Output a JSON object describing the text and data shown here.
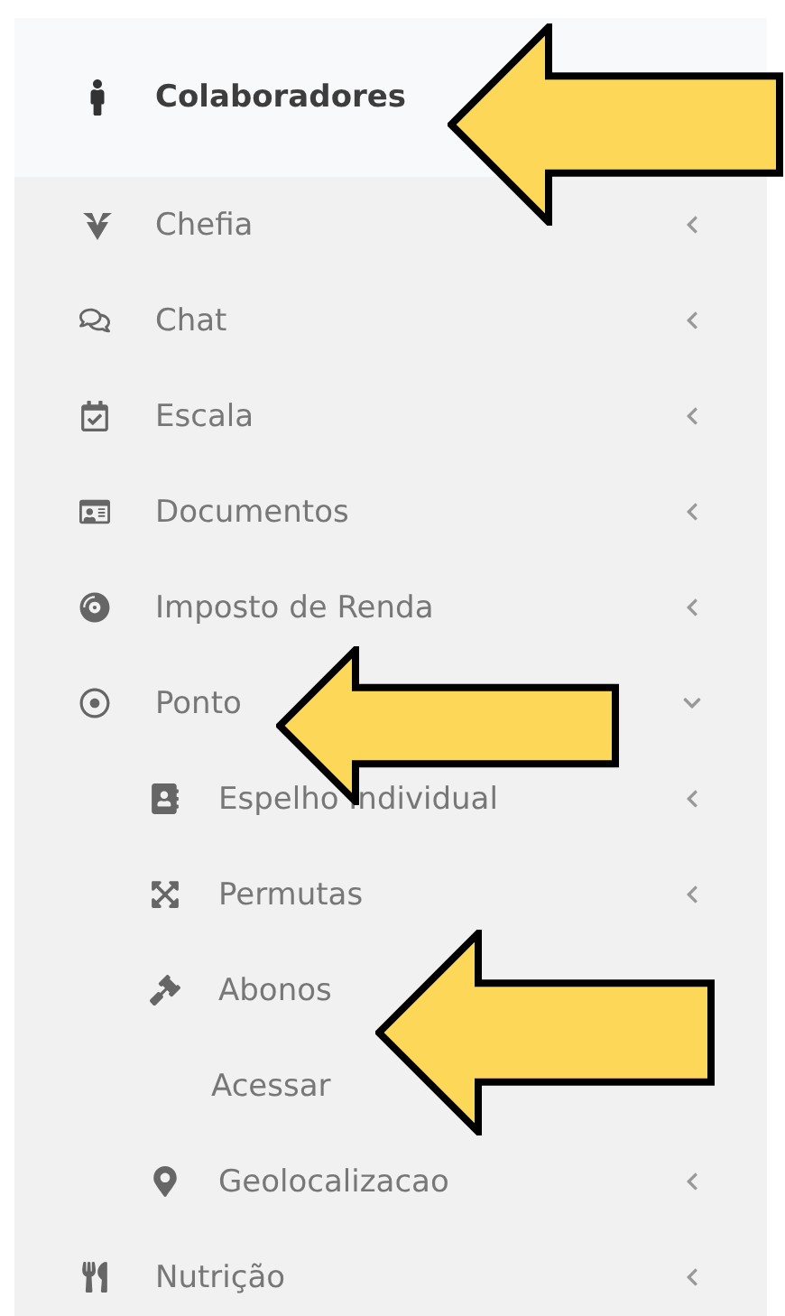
{
  "header": {
    "label": "Colaboradores"
  },
  "menu": [
    {
      "label": "Chefia",
      "expanded": false
    },
    {
      "label": "Chat",
      "expanded": false
    },
    {
      "label": "Escala",
      "expanded": false
    },
    {
      "label": "Documentos",
      "expanded": false
    },
    {
      "label": "Imposto de Renda",
      "expanded": false
    },
    {
      "label": "Ponto",
      "expanded": true,
      "children": [
        {
          "label": "Espelho Individual",
          "expanded": false
        },
        {
          "label": "Permutas",
          "expanded": false
        },
        {
          "label": "Abonos",
          "children": [
            {
              "label": "Acessar"
            }
          ]
        },
        {
          "label": "Geolocalizacao",
          "expanded": false
        }
      ]
    },
    {
      "label": "Nutrição",
      "expanded": false
    }
  ]
}
